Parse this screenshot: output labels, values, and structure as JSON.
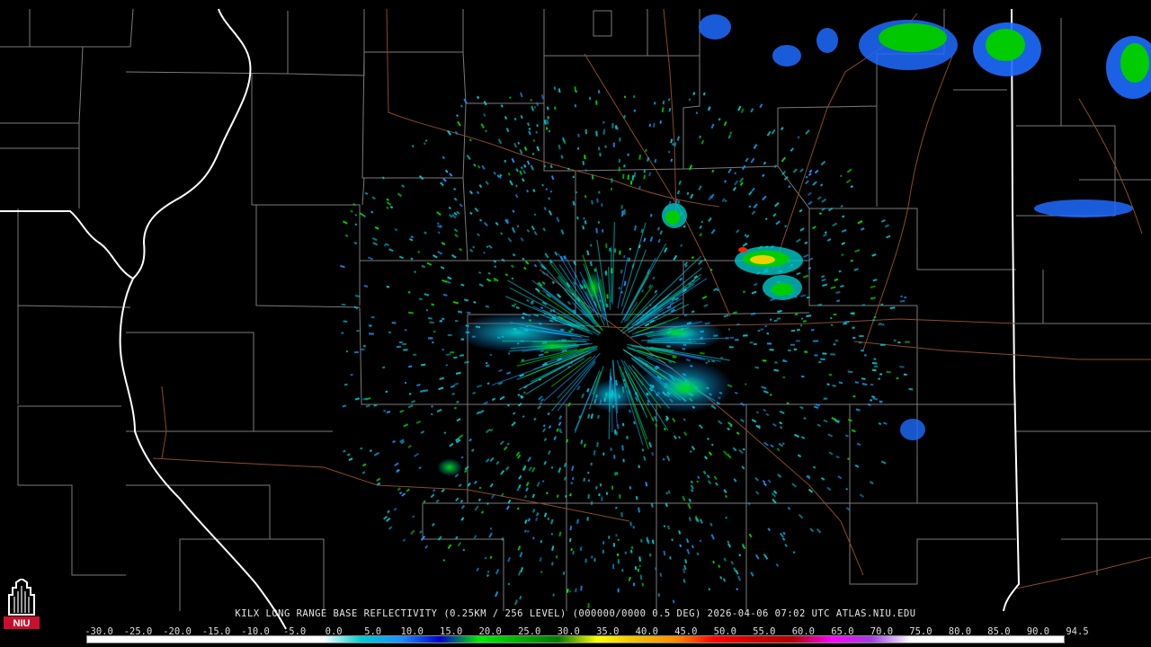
{
  "product": {
    "caption": "KILX LONG RANGE BASE REFLECTIVITY (0.25KM / 256 LEVEL) (000000/0000 0.5 DEG) 2026-04-06 07:02 UTC  ATLAS.NIU.EDU",
    "logo_text": "NIU"
  },
  "colorbar": {
    "labels": [
      "-30.0",
      "-25.0",
      "-20.0",
      "-15.0",
      "-10.0",
      "-5.0",
      "0.0",
      "5.0",
      "10.0",
      "15.0",
      "20.0",
      "25.0",
      "30.0",
      "35.0",
      "40.0",
      "45.0",
      "50.0",
      "55.0",
      "60.0",
      "65.0",
      "70.0",
      "75.0",
      "80.0",
      "85.0",
      "90.0",
      "94.5"
    ],
    "stops": [
      {
        "dbz": -30,
        "color": "#ffffff"
      },
      {
        "dbz": 0,
        "color": "#ffffff"
      },
      {
        "dbz": 5,
        "color": "#00cccc"
      },
      {
        "dbz": 10,
        "color": "#1e90ff"
      },
      {
        "dbz": 15,
        "color": "#0000cc"
      },
      {
        "dbz": 20,
        "color": "#00ee00"
      },
      {
        "dbz": 25,
        "color": "#00b000"
      },
      {
        "dbz": 30,
        "color": "#007a00"
      },
      {
        "dbz": 35,
        "color": "#ffff00"
      },
      {
        "dbz": 40,
        "color": "#f0c000"
      },
      {
        "dbz": 45,
        "color": "#ff8c00"
      },
      {
        "dbz": 50,
        "color": "#ff0000"
      },
      {
        "dbz": 55,
        "color": "#d00000"
      },
      {
        "dbz": 60,
        "color": "#b00000"
      },
      {
        "dbz": 65,
        "color": "#ff00ff"
      },
      {
        "dbz": 70,
        "color": "#a040e0"
      },
      {
        "dbz": 75,
        "color": "#ffffff"
      },
      {
        "dbz": 94.5,
        "color": "#ffffff"
      }
    ]
  },
  "colors": {
    "background": "#000000",
    "county_lines": "#7a7a7a",
    "state_lines": "#ffffff",
    "highways": "#8b4a2b",
    "logo_red": "#c8102e"
  }
}
